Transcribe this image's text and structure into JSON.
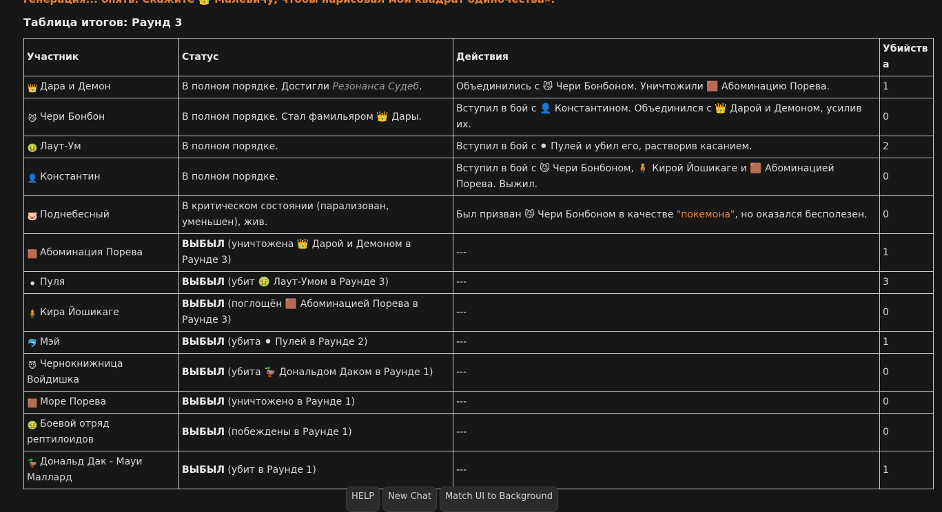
{
  "top_line": "генерация... опять. Скажите 👑 Малевичу, чтобы нарисовал мой квадрат одиночества».",
  "title": "Таблица итогов: Раунд 3",
  "headers": {
    "participant": "Участник",
    "status": "Статус",
    "actions": "Действия",
    "kills": "Убийства"
  },
  "rows": [
    {
      "emoji": "👑",
      "name": "Дара и Демон",
      "status_parts": [
        {
          "t": "В полном порядке. Достигли "
        },
        {
          "t": "Резонанса Судеб",
          "s": "it"
        },
        {
          "t": "."
        }
      ],
      "action_parts": [
        {
          "t": "Объединились с 😼 Чери Бонбоном. Уничтожили 🟫 Абоминацию Порева."
        }
      ],
      "kills": "1"
    },
    {
      "emoji": "😼",
      "name": "Чери Бонбон",
      "status_parts": [
        {
          "t": "В полном порядке. Стал фамильяром 👑 Дары."
        }
      ],
      "action_parts": [
        {
          "t": "Вступил в бой с 👤 Константином. Объединился с 👑 Дарой и Демоном, усилив их."
        }
      ],
      "kills": "0"
    },
    {
      "emoji": "🤢",
      "name": "Лаут-Ум",
      "status_parts": [
        {
          "t": "В полном порядке."
        }
      ],
      "action_parts": [
        {
          "t": "Вступил в бой с ⚫ Пулей и убил его, растворив касанием."
        }
      ],
      "kills": "2"
    },
    {
      "emoji": "👤",
      "name": "Константин",
      "status_parts": [
        {
          "t": "В полном порядке."
        }
      ],
      "action_parts": [
        {
          "t": "Вступил в бой с 😼 Чери Бонбоном, 🧍 Кирой Йошикаге и 🟫 Абоминацией Порева. Выжил."
        }
      ],
      "kills": "0"
    },
    {
      "emoji": "🐷",
      "name": "Поднебесный",
      "status_parts": [
        {
          "t": "В критическом состоянии (парализован, уменьшен), жив."
        }
      ],
      "action_parts": [
        {
          "t": "Был призван 😼 Чери Бонбоном в качестве "
        },
        {
          "t": "\"покемона\"",
          "s": "orange"
        },
        {
          "t": ", но оказался бесполезен."
        }
      ],
      "kills": "0"
    },
    {
      "emoji": "🟫",
      "name": "Абоминация Порева",
      "status_parts": [
        {
          "t": "ВЫБЫЛ",
          "s": "b"
        },
        {
          "t": " (уничтожена 👑 Дарой и Демоном в Раунде 3)"
        }
      ],
      "action_parts": [
        {
          "t": "---"
        }
      ],
      "kills": "1"
    },
    {
      "emoji": "⚫",
      "name": "Пуля",
      "status_parts": [
        {
          "t": "ВЫБЫЛ",
          "s": "b"
        },
        {
          "t": " (убит 🤢 Лаут-Умом в Раунде 3)"
        }
      ],
      "action_parts": [
        {
          "t": "---"
        }
      ],
      "kills": "3"
    },
    {
      "emoji": "🧍",
      "name": "Кира Йошикаге",
      "status_parts": [
        {
          "t": "ВЫБЫЛ",
          "s": "b"
        },
        {
          "t": " (поглощён 🟫 Абоминацией Порева в Раунде 3)"
        }
      ],
      "action_parts": [
        {
          "t": "---"
        }
      ],
      "kills": "0"
    },
    {
      "emoji": "🐬",
      "name": "Мэй",
      "status_parts": [
        {
          "t": "ВЫБЫЛ",
          "s": "b"
        },
        {
          "t": " (убита ⚫ Пулей в Раунде 2)"
        }
      ],
      "action_parts": [
        {
          "t": "---"
        }
      ],
      "kills": "1"
    },
    {
      "emoji": "😈",
      "name": "Чернокнижница Войдишка",
      "status_parts": [
        {
          "t": "ВЫБЫЛ",
          "s": "b"
        },
        {
          "t": " (убита 🦆 Дональдом Даком в Раунде 1)"
        }
      ],
      "action_parts": [
        {
          "t": "---"
        }
      ],
      "kills": "0"
    },
    {
      "emoji": "🟫",
      "name": "Море Порева",
      "status_parts": [
        {
          "t": "ВЫБЫЛ",
          "s": "b"
        },
        {
          "t": " (уничтожено в Раунде 1)"
        }
      ],
      "action_parts": [
        {
          "t": "---"
        }
      ],
      "kills": "0"
    },
    {
      "emoji": "🤢",
      "name": "Боевой отряд рептилоидов",
      "status_parts": [
        {
          "t": "ВЫБЫЛ",
          "s": "b"
        },
        {
          "t": " (побеждены в Раунде 1)"
        }
      ],
      "action_parts": [
        {
          "t": "---"
        }
      ],
      "kills": "0"
    },
    {
      "emoji": "🦆",
      "name": "Дональд Дак - Мауи Маллард",
      "status_parts": [
        {
          "t": "ВЫБЫЛ",
          "s": "b"
        },
        {
          "t": " (убит в Раунде 1)"
        }
      ],
      "action_parts": [
        {
          "t": "---"
        }
      ],
      "kills": "1"
    }
  ],
  "bottom_buttons": [
    "HELP",
    "New Chat",
    "Match UI to Background"
  ],
  "colors": {
    "background": "#171717",
    "accent": "#e5813a",
    "border": "#c9c9c9"
  }
}
